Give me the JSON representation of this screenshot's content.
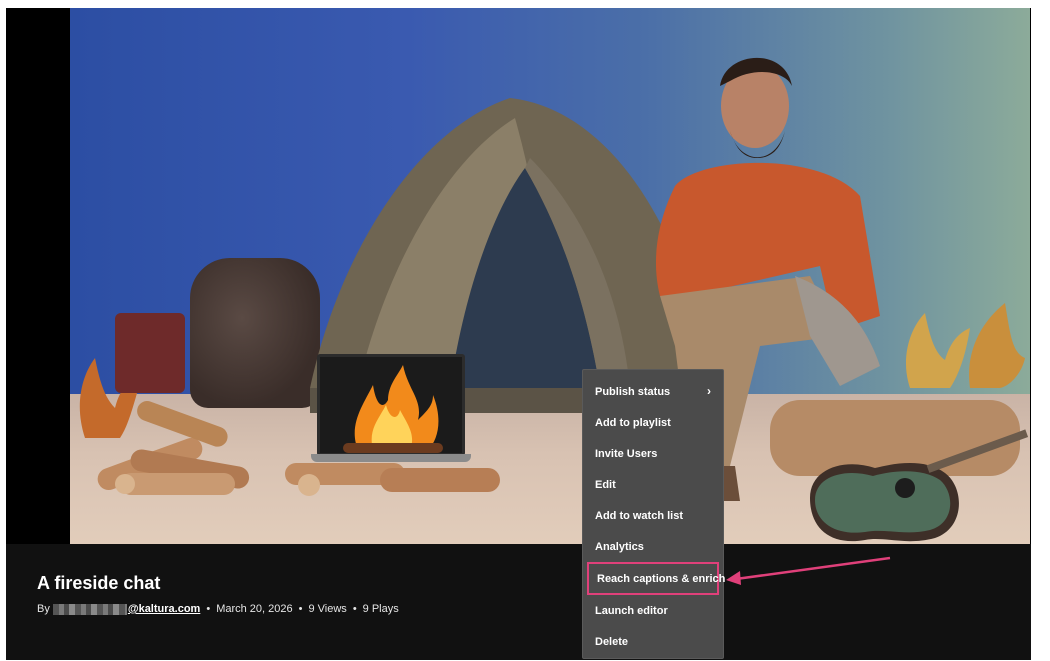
{
  "video": {
    "title": "A fireside chat",
    "by_label": "By",
    "author_domain": "@kaltura.com",
    "date": "March 20, 2026",
    "views": "9 Views",
    "plays": "9 Plays",
    "separator": "•"
  },
  "context_menu": {
    "items": [
      {
        "label": "Publish status",
        "has_submenu": true
      },
      {
        "label": "Add to playlist"
      },
      {
        "label": "Invite Users"
      },
      {
        "label": "Edit"
      },
      {
        "label": "Add to watch list"
      },
      {
        "label": "Analytics"
      },
      {
        "label": "Reach captions & enrich",
        "highlighted": true
      },
      {
        "label": "Launch editor"
      },
      {
        "label": "Delete"
      }
    ],
    "submenu_icon": "chevron-right-icon"
  },
  "annotation": {
    "color": "#e0407a"
  },
  "colors": {
    "info_bar": "#111111",
    "menu_bg": "#4b4b4b",
    "highlight": "#e0407a"
  }
}
